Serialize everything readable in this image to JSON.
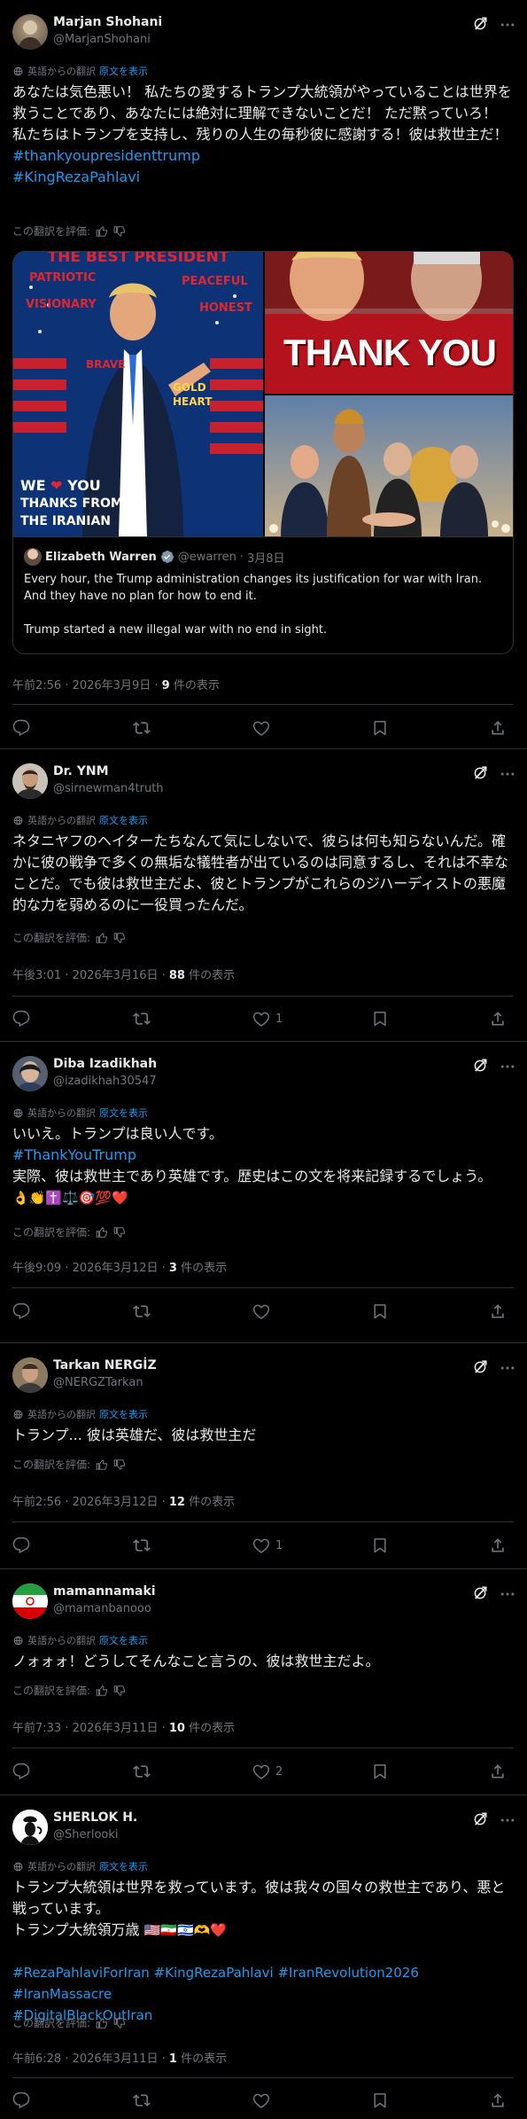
{
  "common": {
    "translated_from": "英語からの翻訳",
    "show_original": "原文を表示",
    "rate_translation": "この翻訳を評価:",
    "views_suffix": "件の表示"
  },
  "posts": [
    {
      "name": "Marjan Shohani",
      "handle": "@MarjanShohani",
      "text": "あなたは気色悪い！ 私たちの愛するトランプ大統領がやっていることは世界を救うことであり、あなたには絶対に理解できないことだ！ ただ黙っていろ！ 私たちはトランプを支持し、残りの人生の毎秒彼に感謝する！彼は救世主だ！",
      "hashtags": [
        "#thankyoupresidenttrump",
        "#KingRezaPahlavi"
      ],
      "images": {
        "left": {
          "top": "THE BEST PRESIDENT",
          "tl": "PATRIOTIC",
          "ml": "VISIONARY",
          "tr": "PEACEFUL",
          "mr": "HONEST",
          "c1": "BRAVE",
          "c2": "GOLD",
          "c3": "HEART",
          "b1": "WE",
          "b2": "YOU",
          "b3": "THANKS FROM",
          "b4": "THE IRANIAN"
        },
        "right_top": "THANK YOU"
      },
      "quote": {
        "name": "Elizabeth Warren",
        "handle": "@ewarren",
        "date": "3月8日",
        "line1": "Every hour, the Trump administration changes its justification for war with Iran. And they have no plan for how to end it.",
        "line2": "Trump started a new illegal war with no end in sight."
      },
      "time": "午前2:56 · 2026年3月9日 · ",
      "views": "9",
      "likes": "",
      "avatar_color": "#8a7a66"
    },
    {
      "name": "Dr. YNM",
      "handle": "@sirnewman4truth",
      "text": "ネタニヤフのヘイターたちなんて気にしないで、彼らは何も知らないんだ。確かに彼の戦争で多くの無垢な犠牲者が出ているのは同意するし、それは不幸なことだ。でも彼は救世主だよ、彼とトランプがこれらのジハーディストの悪魔的な力を弱めるのに一役買ったんだ。",
      "time": "午後3:01 · 2026年3月16日 · ",
      "views": "88",
      "likes": "1"
    },
    {
      "name": "Diba Izadikhah",
      "handle": "@izadikhah30547",
      "text_line1": "いいえ。トランプは良い人です。",
      "hashtag": "#ThankYouTrump",
      "text_line2": "実際、彼は救世主であり英雄です。歴史はこの文を将来記録するでしょう。",
      "emojis": "👌👏✝️⚖️🎯💯❤️",
      "time": "午後9:09 · 2026年3月12日 · ",
      "views": "3",
      "likes": ""
    },
    {
      "name": "Tarkan NERGİZ",
      "handle": "@NERGZTarkan",
      "text": "トランプ... 彼は英雄だ、彼は救世主だ",
      "time": "午前2:56 · 2026年3月12日 · ",
      "views": "12",
      "likes": "1"
    },
    {
      "name": "mamannamaki",
      "handle": "@mamanbanooo",
      "text": "ノォォォ！どうしてそんなこと言うの、彼は救世主だよ。",
      "time": "午前7:33 · 2026年3月11日 · ",
      "views": "10",
      "likes": "2"
    },
    {
      "name": "SHERLOK H.",
      "handle": "@Sherlooki",
      "text": "トランプ大統領は世界を救っています。彼は我々の国々の救世主であり、悪と戦っています。",
      "text_line3": "トランプ大統領万歳",
      "emojis": "🇺🇸🇮🇷🇮🇱🫶❤️",
      "hashtags_line1": "#RezaPahlaviForIran #KingRezaPahlavi #IranRevolution2026 #IranMassacre",
      "hashtags_line2": "#DigitalBlackOutIran",
      "time": "午前6:28 · 2026年3月11日 · ",
      "views": "1",
      "likes": ""
    }
  ],
  "icons": {
    "reply": "reply-icon",
    "repost": "repost-icon",
    "like": "like-icon",
    "bookmark": "bookmark-icon",
    "share": "share-icon",
    "grok": "grok-icon",
    "more": "more-icon",
    "translate": "translate-icon",
    "thumb_up": "thumb-up-icon",
    "thumb_down": "thumb-down-icon"
  },
  "colors": {
    "accent": "#1d9bf0",
    "muted": "#71767b",
    "text": "#e7e9ea",
    "bg": "#000000",
    "border": "#2f3336"
  }
}
